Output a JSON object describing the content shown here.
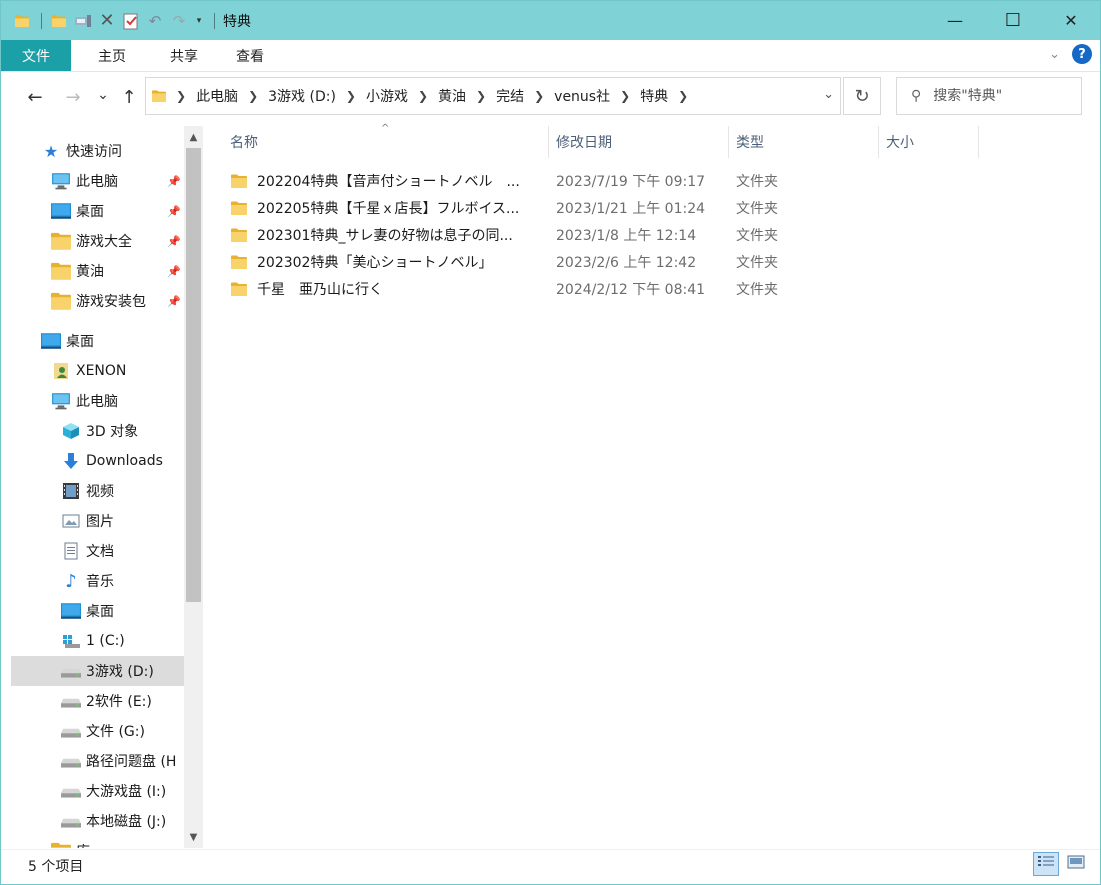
{
  "window": {
    "title": "特典",
    "accent_color": "#7fd3d6",
    "file_tab_color": "#1aa0a6"
  },
  "quick_access_toolbar": {
    "icons": [
      "folder-icon",
      "folder-icon",
      "properties-icon",
      "delete-icon",
      "checklist-icon",
      "undo-icon",
      "redo-icon",
      "customize-dropdown-icon"
    ]
  },
  "window_controls": {
    "minimize": "—",
    "maximize": "☐",
    "close": "✕"
  },
  "ribbon": {
    "tabs": [
      "文件",
      "主页",
      "共享",
      "查看"
    ],
    "help": "?"
  },
  "navigation": {
    "back": "←",
    "forward": "→",
    "recent": "⌄",
    "up": "↑"
  },
  "address_bar": {
    "crumbs": [
      "此电脑",
      "3游戏 (D:)",
      "小游戏",
      "黄油",
      "完结",
      "venus社",
      "特典"
    ]
  },
  "search": {
    "placeholder": "搜索\"特典\""
  },
  "nav_pane": {
    "quick_access": {
      "label": "快速访问",
      "items": [
        {
          "label": "此电脑",
          "icon": "pc-icon",
          "pinned": true
        },
        {
          "label": "桌面",
          "icon": "desktop-icon",
          "pinned": true
        },
        {
          "label": "游戏大全",
          "icon": "folder-icon",
          "pinned": true
        },
        {
          "label": "黄油",
          "icon": "folder-icon",
          "pinned": true
        },
        {
          "label": "游戏安装包",
          "icon": "folder-icon",
          "pinned": true
        }
      ]
    },
    "desktop": {
      "label": "桌面",
      "items": [
        {
          "label": "XENON",
          "icon": "user-icon"
        },
        {
          "label": "此电脑",
          "icon": "pc-icon"
        }
      ]
    },
    "this_pc_items": [
      {
        "label": "3D 对象",
        "icon": "cube-icon"
      },
      {
        "label": "Downloads",
        "icon": "download-icon"
      },
      {
        "label": "视频",
        "icon": "video-icon"
      },
      {
        "label": "图片",
        "icon": "picture-icon"
      },
      {
        "label": "文档",
        "icon": "document-icon"
      },
      {
        "label": "音乐",
        "icon": "music-icon"
      },
      {
        "label": "桌面",
        "icon": "desktop-icon"
      },
      {
        "label": "1 (C:)",
        "icon": "windows-drive-icon"
      },
      {
        "label": "3游戏 (D:)",
        "icon": "drive-icon",
        "selected": true
      },
      {
        "label": "2软件 (E:)",
        "icon": "drive-icon"
      },
      {
        "label": "文件 (G:)",
        "icon": "drive-icon"
      },
      {
        "label": "路径问题盘 (H",
        "icon": "drive-icon"
      },
      {
        "label": "大游戏盘 (I:)",
        "icon": "drive-icon"
      },
      {
        "label": "本地磁盘 (J:)",
        "icon": "drive-icon"
      },
      {
        "label": "库",
        "icon": "library-icon"
      }
    ]
  },
  "file_list": {
    "columns": [
      "名称",
      "修改日期",
      "类型",
      "大小"
    ],
    "rows": [
      {
        "name": "202204特典【音声付ショートノベル　...",
        "date": "2023/7/19 下午 09:17",
        "type": "文件夹"
      },
      {
        "name": "202205特典【千星ｘ店長】フルボイス...",
        "date": "2023/1/21 上午 01:24",
        "type": "文件夹"
      },
      {
        "name": "202301特典_サレ妻の好物は息子の同...",
        "date": "2023/1/8 上午 12:14",
        "type": "文件夹"
      },
      {
        "name": "202302特典「美心ショートノベル」",
        "date": "2023/2/6 上午 12:42",
        "type": "文件夹"
      },
      {
        "name": "千星　亜乃山に行く",
        "date": "2024/2/12 下午 08:41",
        "type": "文件夹"
      }
    ]
  },
  "status_bar": {
    "count": "5 个项目"
  }
}
